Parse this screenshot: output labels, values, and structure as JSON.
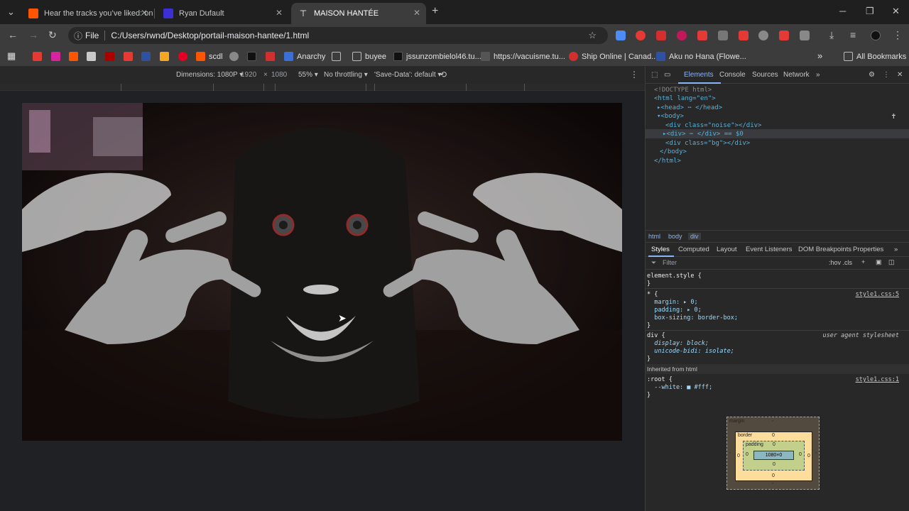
{
  "tabs": [
    {
      "title": "Hear the tracks you’ve liked: on",
      "color": "#ff5500"
    },
    {
      "title": "Ryan Dufault",
      "color": "#3d2fd6"
    },
    {
      "title": "MAISON HANTÉE",
      "color": "#ffffff"
    }
  ],
  "address": {
    "scheme_label": "File",
    "url": "C:/Users/rwnd/Desktop/portail-maison-hantee/1.html"
  },
  "bookmarks": [
    {
      "label": "scdl"
    },
    {
      "label": "Anarchy"
    },
    {
      "label": "buyee"
    },
    {
      "label": "jssunzombielol46.tu..."
    },
    {
      "label": "https://vacuisme.tu..."
    },
    {
      "label": "Ship Online | Canad..."
    },
    {
      "label": "Aku no Hana (Flowe..."
    },
    {
      "label": "All Bookmarks"
    }
  ],
  "device_toolbar": {
    "dimensions": "Dimensions: 1080P ▾",
    "width": "1920",
    "times": "×",
    "height": "1080",
    "zoom": "55% ▾",
    "throttling": "No throttling ▾",
    "save_data": "'Save-Data': default ▾"
  },
  "devtools": {
    "tabs": [
      "Elements",
      "Console",
      "Sources",
      "Network"
    ],
    "dom_lines": [
      {
        "t": "<!DOCTYPE html>"
      },
      {
        "t": "<html lang=\"en\">"
      },
      {
        "t": "▸<head> ⋯ </head>"
      },
      {
        "t": "▾<body>"
      },
      {
        "t": "<div class=\"noise\"></div>"
      },
      {
        "t": "▸<div> ⋯ </div> == $0"
      },
      {
        "t": "<div class=\"bg\"></div>"
      },
      {
        "t": "</body>"
      },
      {
        "t": "</html>"
      }
    ],
    "breadcrumbs": [
      "html",
      "body",
      "div"
    ],
    "sub_tabs": [
      "Styles",
      "Computed",
      "Layout",
      "Event Listeners",
      "DOM Breakpoints",
      "Properties"
    ],
    "filter_placeholder": "Filter",
    "filter_tools": ":hov .cls",
    "styles_lines": [
      {
        "t": "element.style {"
      },
      {
        "t": "}"
      },
      {
        "t": "* {",
        "src": "style1.css:5"
      },
      {
        "t": "  margin: ▸ 0;"
      },
      {
        "t": "  padding: ▸ 0;"
      },
      {
        "t": "  box-sizing: border-box;"
      },
      {
        "t": "}"
      },
      {
        "t": "div {",
        "src": "user agent stylesheet"
      },
      {
        "t": "  display: block;"
      },
      {
        "t": "  unicode-bidi: isolate;"
      },
      {
        "t": "}"
      },
      {
        "t": "Inherited from html"
      },
      {
        "t": ":root {",
        "src": "style1.css:1"
      },
      {
        "t": "  --white: ■ #fff;"
      },
      {
        "t": "}"
      }
    ],
    "box_model": {
      "margin": "margin",
      "border": "border",
      "padding": "padding",
      "content": "1080×0",
      "zero": "0",
      "dash": "-"
    }
  }
}
